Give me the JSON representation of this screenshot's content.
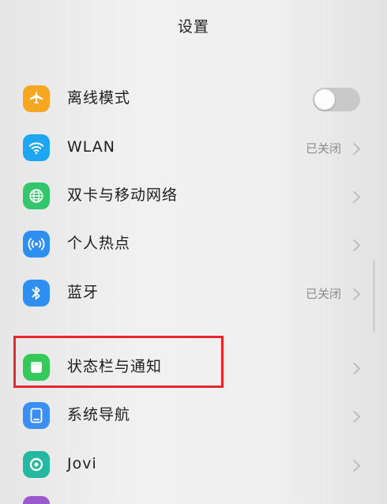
{
  "header": {
    "title": "设置"
  },
  "colors": {
    "airplane": "#f5a623",
    "wifi": "#1ea7f0",
    "sim": "#32c76a",
    "hotspot": "#2f8ff0",
    "bluetooth": "#2f8ff0",
    "statusbar": "#35c95a",
    "navigation": "#3b8ef2",
    "jovi": "#24b8a0",
    "highlight": "#e8262b"
  },
  "settings": {
    "items": [
      {
        "label": "离线模式",
        "icon": "airplane-icon",
        "control": "toggle",
        "toggle_on": false
      },
      {
        "label": "WLAN",
        "icon": "wifi-icon",
        "value": "已关闭"
      },
      {
        "label": "双卡与移动网络",
        "icon": "globe-icon"
      },
      {
        "label": "个人热点",
        "icon": "hotspot-icon"
      },
      {
        "label": "蓝牙",
        "icon": "bluetooth-icon",
        "value": "已关闭"
      },
      {
        "label": "状态栏与通知",
        "icon": "statusbar-icon",
        "highlighted": true
      },
      {
        "label": "系统导航",
        "icon": "navigation-icon"
      },
      {
        "label": "Jovi",
        "icon": "jovi-icon"
      }
    ]
  }
}
